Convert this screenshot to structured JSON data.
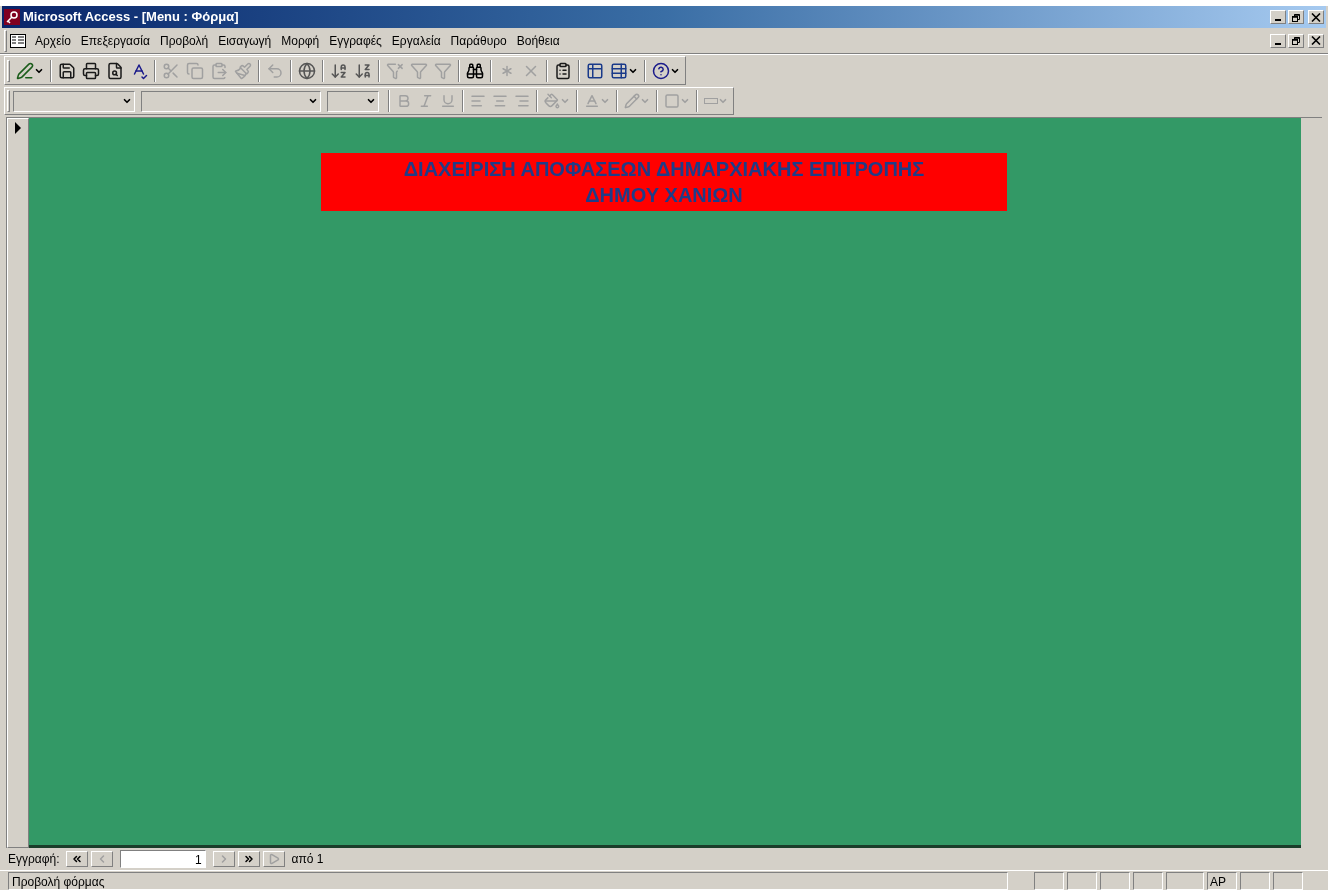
{
  "window": {
    "title": "Microsoft Access - [Menu : Φόρμα]"
  },
  "menu": [
    "Αρχείο",
    "Επεξεργασία",
    "Προβολή",
    "Εισαγωγή",
    "Μορφή",
    "Εγγραφές",
    "Εργαλεία",
    "Παράθυρο",
    "Βοήθεια"
  ],
  "toolbar_standard": [
    {
      "disabled": false
    },
    {
      "disabled": false
    },
    {
      "disabled": false
    },
    {
      "disabled": false
    },
    {
      "disabled": false
    },
    {
      "disabled": true
    },
    {
      "disabled": true
    },
    {
      "disabled": true
    },
    {
      "disabled": true
    },
    {
      "disabled": true
    },
    {
      "disabled": false
    },
    {
      "disabled": false
    },
    {
      "disabled": false
    },
    {
      "disabled": true
    },
    {
      "disabled": true
    },
    {
      "disabled": true
    },
    {
      "disabled": false
    },
    {
      "disabled": true
    },
    {
      "disabled": true
    },
    {
      "disabled": false
    },
    {
      "disabled": false
    },
    {
      "disabled": false
    },
    {
      "disabled": false
    }
  ],
  "toolbar_formatting": [
    {
      "disabled": true
    },
    {
      "disabled": true
    },
    {
      "disabled": true
    },
    {
      "disabled": true
    },
    {
      "disabled": true
    },
    {
      "disabled": true
    },
    {
      "disabled": true
    },
    {
      "disabled": true
    },
    {
      "disabled": true
    },
    {
      "disabled": true
    },
    {
      "disabled": true
    },
    {
      "disabled": true
    },
    {
      "disabled": true
    },
    {
      "disabled": true
    }
  ],
  "form": {
    "heading_lines": [
      "ΔΙΑΧΕΙΡΙΣΗ ΑΠΟΦΑΣΕΩΝ ΔΗΜΑΡΧΙΑΚΗΣ ΕΠΙΤΡΟΠΗΣ",
      "ΔΗΜΟΥ ΧΑΝΙΩΝ"
    ]
  },
  "record_navigation": {
    "label": "Εγγραφή:",
    "current": "1",
    "total": "από 1",
    "buttons": [
      {
        "disabled": false
      },
      {
        "disabled": true
      },
      {
        "disabled": true
      },
      {
        "disabled": false
      },
      {
        "disabled": true
      }
    ]
  },
  "status_bar": {
    "text": "Προβολή φόρμας",
    "indicator": "AP"
  }
}
